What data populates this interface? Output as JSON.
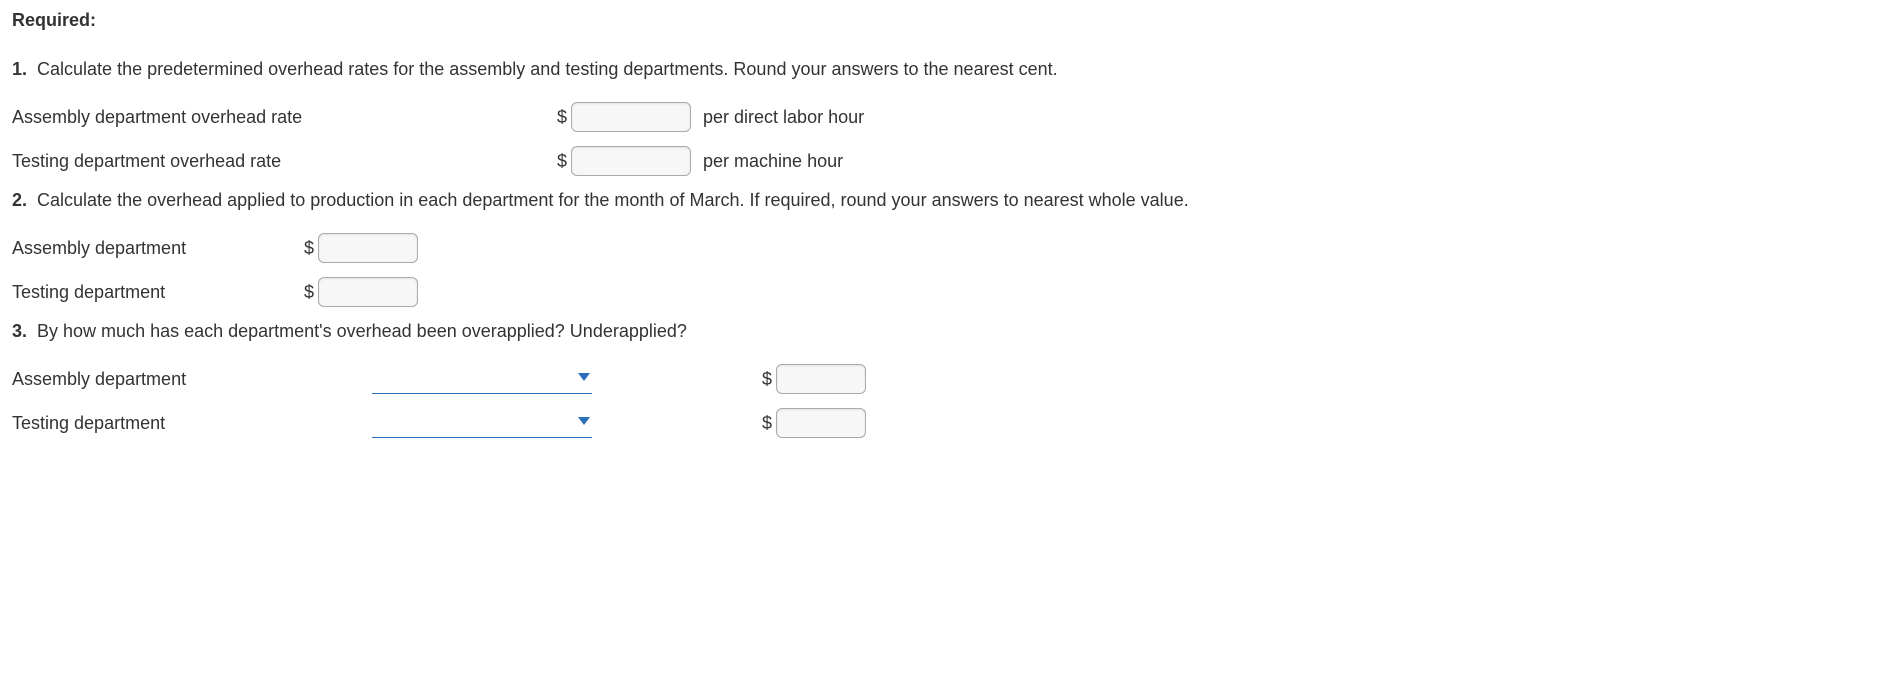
{
  "heading": "Required:",
  "q1": {
    "num": "1.",
    "text": "Calculate the predetermined overhead rates for the assembly and testing departments. Round your answers to the nearest cent.",
    "rows": [
      {
        "label": "Assembly department overhead rate",
        "currency": "$",
        "value": "",
        "suffix": "per direct labor hour"
      },
      {
        "label": "Testing department overhead rate",
        "currency": "$",
        "value": "",
        "suffix": "per machine hour"
      }
    ]
  },
  "q2": {
    "num": "2.",
    "text": "Calculate the overhead applied to production in each department for the month of March. If required, round your answers to nearest whole value.",
    "rows": [
      {
        "label": "Assembly department",
        "currency": "$",
        "value": ""
      },
      {
        "label": "Testing department",
        "currency": "$",
        "value": ""
      }
    ]
  },
  "q3": {
    "num": "3.",
    "text": "By how much has each department's overhead been overapplied? Underapplied?",
    "rows": [
      {
        "label": "Assembly department",
        "select_value": "",
        "currency": "$",
        "value": ""
      },
      {
        "label": "Testing department",
        "select_value": "",
        "currency": "$",
        "value": ""
      }
    ]
  }
}
